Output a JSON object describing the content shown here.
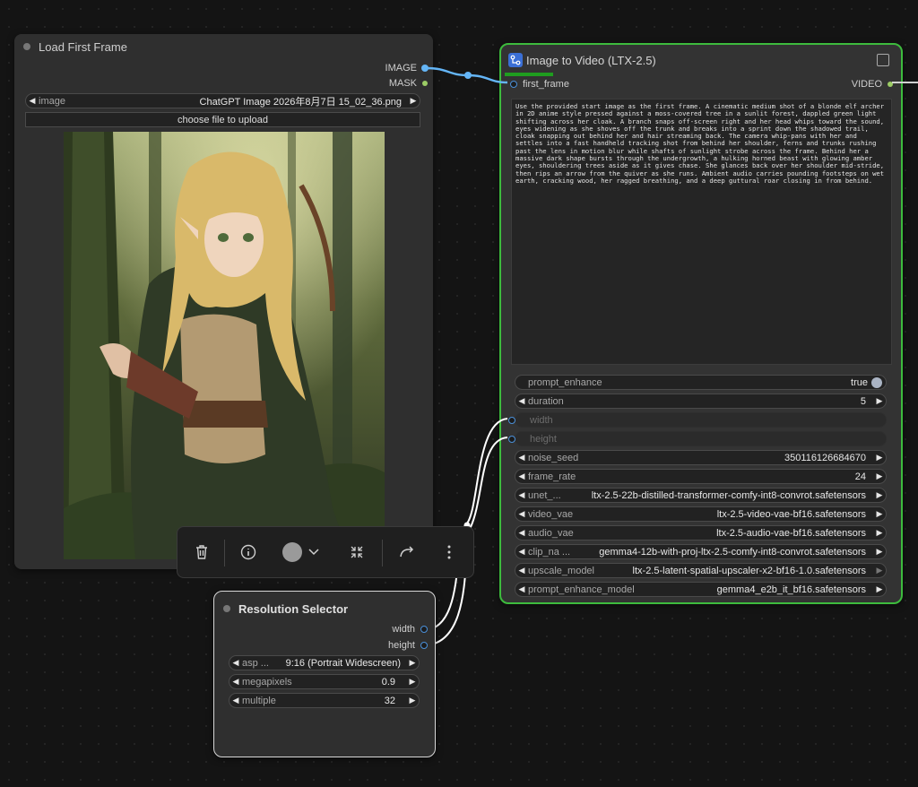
{
  "load_node": {
    "title": "Load First Frame",
    "outputs": [
      "IMAGE",
      "MASK"
    ],
    "image_label": "image",
    "image_value": "ChatGPT Image 2026年8月7日 15_02_36.png",
    "upload_label": "choose file to upload"
  },
  "i2v_node": {
    "title": "Image to Video (LTX-2.5)",
    "input_label": "first_frame",
    "output_label": "VIDEO",
    "prompt": "Use the provided start image as the first frame. A cinematic medium shot of a blonde elf archer in 2D anime style pressed against a moss-covered tree in a sunlit forest, dappled green light shifting across her cloak. A branch snaps off-screen right and her head whips toward the sound, eyes widening as she shoves off the trunk and breaks into a sprint down the shadowed trail, cloak snapping out behind her and hair streaming back. The camera whip-pans with her and settles into a fast handheld tracking shot from behind her shoulder, ferns and trunks rushing past the lens in motion blur while shafts of sunlight strobe across the frame. Behind her a massive dark shape bursts through the undergrowth, a hulking horned beast with glowing amber eyes, shouldering trees aside as it gives chase. She glances back over her shoulder mid-stride, then rips an arrow from the quiver as she runs. Ambient audio carries pounding footsteps on wet earth, cracking wood, her ragged breathing, and a deep guttural roar closing in from behind.",
    "widgets": {
      "prompt_enhance": {
        "label": "prompt_enhance",
        "value": "true"
      },
      "duration": {
        "label": "duration",
        "value": "5"
      },
      "width": {
        "label": "width"
      },
      "height": {
        "label": "height"
      },
      "noise_seed": {
        "label": "noise_seed",
        "value": "350116126684670"
      },
      "frame_rate": {
        "label": "frame_rate",
        "value": "24"
      },
      "unet": {
        "label": "unet_...",
        "value": "ltx-2.5-22b-distilled-transformer-comfy-int8-convrot.safetensors"
      },
      "video_vae": {
        "label": "video_vae",
        "value": "ltx-2.5-video-vae-bf16.safetensors"
      },
      "audio_vae": {
        "label": "audio_vae",
        "value": "ltx-2.5-audio-vae-bf16.safetensors"
      },
      "clip": {
        "label": "clip_na ...",
        "value": "gemma4-12b-with-proj-ltx-2.5-comfy-int8-convrot.safetensors"
      },
      "upscale_model": {
        "label": "upscale_model",
        "value": "ltx-2.5-latent-spatial-upscaler-x2-bf16-1.0.safetensors"
      },
      "prompt_enhance_model": {
        "label": "prompt_enhance_model",
        "value": "gemma4_e2b_it_bf16.safetensors"
      }
    }
  },
  "res_node": {
    "title": "Resolution Selector",
    "outputs": [
      "width",
      "height"
    ],
    "widgets": {
      "aspect": {
        "label": "asp ...",
        "value": "9:16 (Portrait Widescreen)"
      },
      "megapixels": {
        "label": "megapixels",
        "value": "0.9"
      },
      "multiple": {
        "label": "multiple",
        "value": "32"
      }
    }
  },
  "colors": {
    "selected_border": "#3dbb3d",
    "image_wire": "#64b5f6",
    "int_wire": "#ffffff",
    "badge": "#3b6fd6"
  }
}
